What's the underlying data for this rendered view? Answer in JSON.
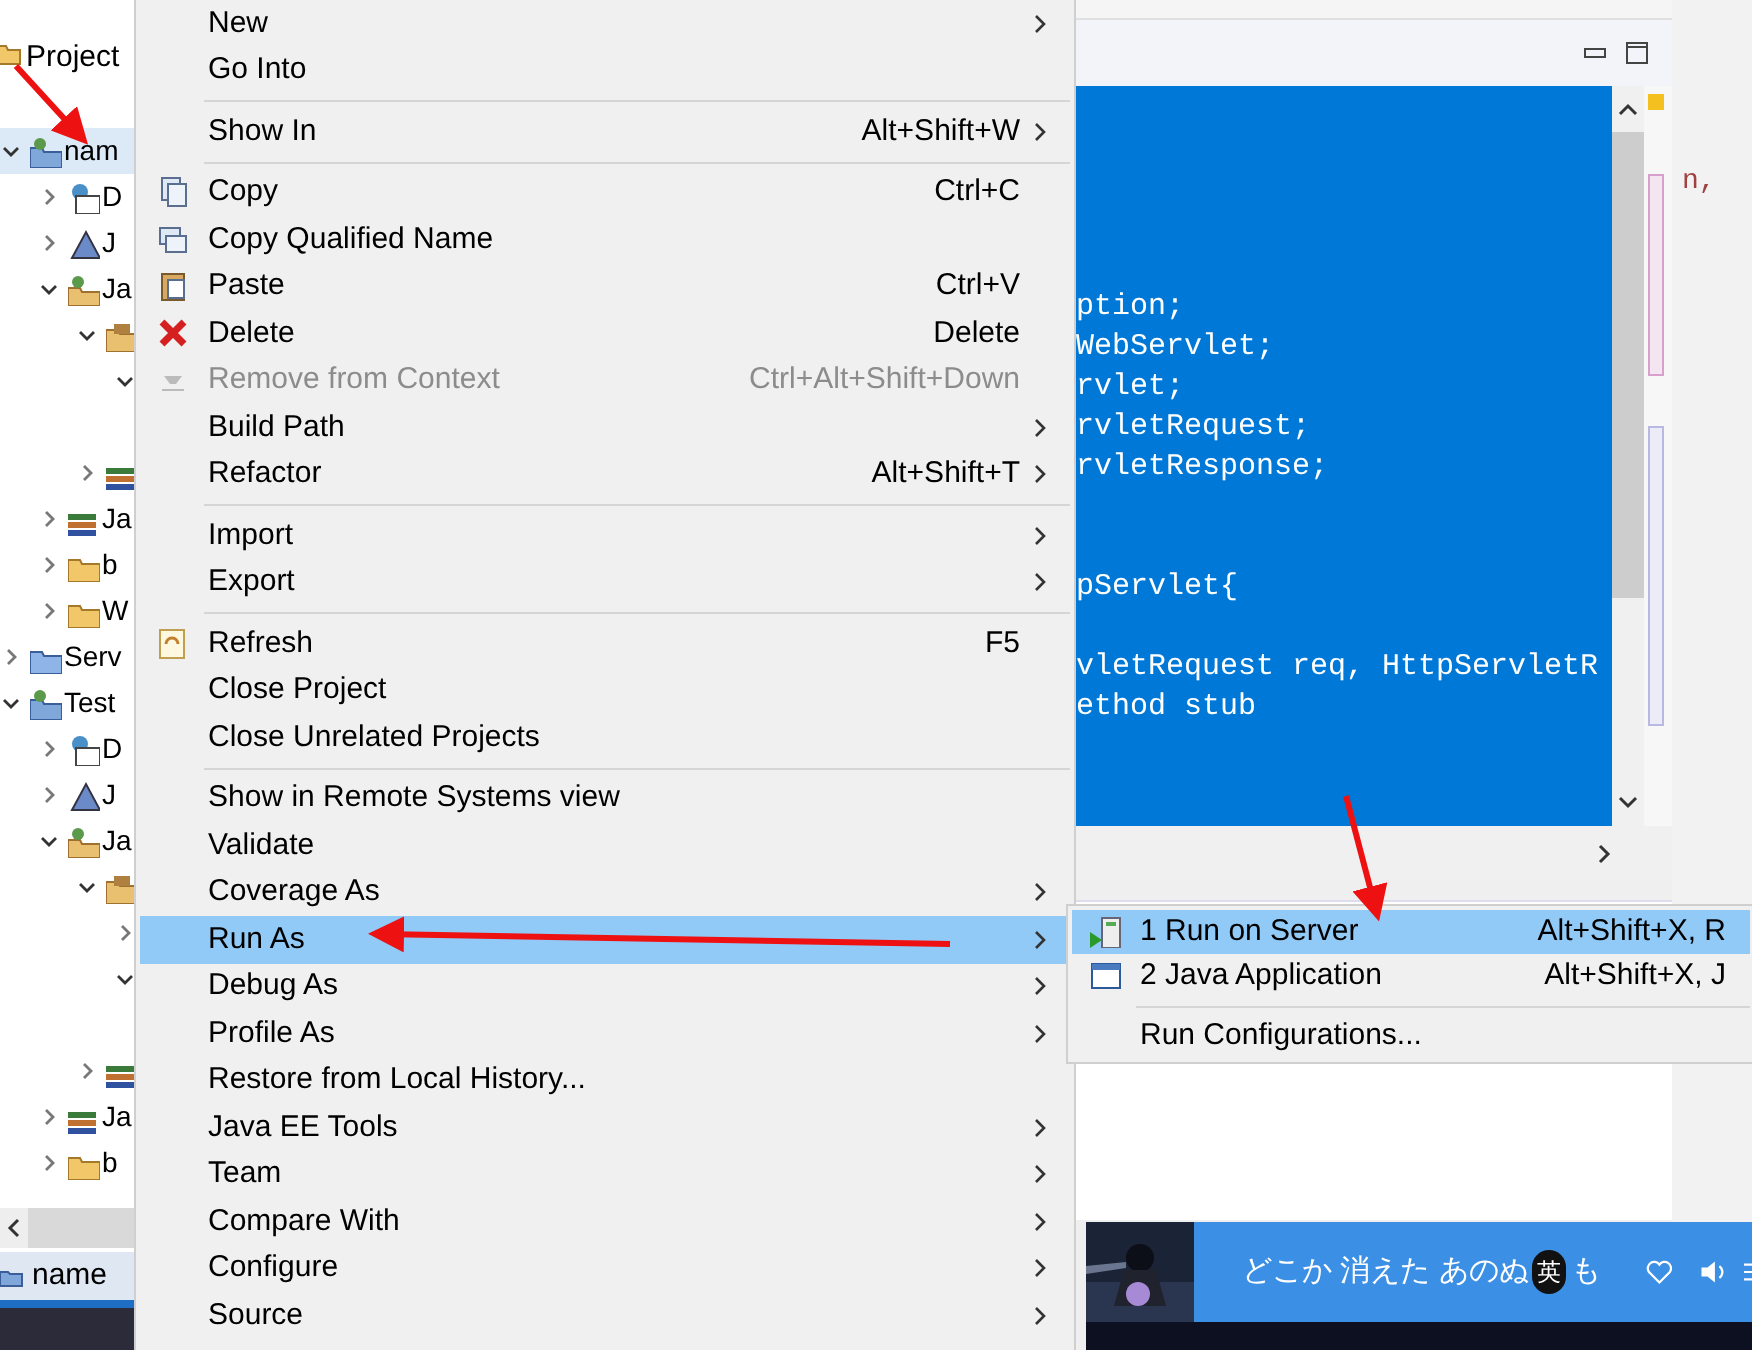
{
  "explorer": {
    "title": "Project",
    "tree": [
      {
        "label": "nam",
        "kind": "project",
        "expanded": true,
        "selected": true,
        "children": [
          {
            "label": "D",
            "kind": "descriptor",
            "expanded": false,
            "selected": false
          },
          {
            "label": "J",
            "kind": "webservices",
            "expanded": false,
            "selected": false
          },
          {
            "label": "Ja",
            "kind": "resources",
            "expanded": true,
            "selected": false,
            "children": [
              {
                "kind": "package",
                "expanded": true,
                "selected": false,
                "children": [
                  {
                    "kind": "none",
                    "expanded": true,
                    "selected": false
                  }
                ]
              },
              {
                "kind": "library",
                "expanded": false,
                "selected": false
              }
            ]
          },
          {
            "label": "Ja",
            "kind": "library",
            "expanded": false,
            "selected": false
          },
          {
            "label": "b",
            "kind": "folder",
            "expanded": false,
            "selected": false
          },
          {
            "label": "W",
            "kind": "folder",
            "expanded": false,
            "selected": false
          }
        ]
      },
      {
        "label": "Serv",
        "kind": "servers",
        "expanded": false,
        "selected": false
      },
      {
        "label": "Test",
        "kind": "project",
        "expanded": true,
        "selected": false,
        "children": [
          {
            "label": "D",
            "kind": "descriptor",
            "expanded": false,
            "selected": false
          },
          {
            "label": "J",
            "kind": "webservices",
            "expanded": false,
            "selected": false
          },
          {
            "label": "Ja",
            "kind": "resources",
            "expanded": true,
            "selected": false,
            "children": [
              {
                "kind": "package",
                "expanded": true,
                "selected": false,
                "children": [
                  {
                    "kind": "none",
                    "expanded": false,
                    "selected": false
                  },
                  {
                    "kind": "none",
                    "expanded": true,
                    "selected": false
                  }
                ]
              },
              {
                "kind": "library",
                "expanded": false,
                "selected": false
              }
            ]
          },
          {
            "label": "Ja",
            "kind": "library",
            "expanded": false,
            "selected": false
          },
          {
            "label": "b",
            "kind": "folder",
            "expanded": false,
            "selected": false
          }
        ]
      }
    ],
    "bottom_tab": "name"
  },
  "context_menu": [
    {
      "kind": "item",
      "label": "New",
      "submenu": true,
      "selected": false,
      "disabled": false
    },
    {
      "kind": "item",
      "label": "Go Into",
      "selected": false,
      "disabled": false
    },
    {
      "kind": "separator"
    },
    {
      "kind": "item",
      "label": "Show In",
      "shortcut": "Alt+Shift+W",
      "submenu": true,
      "selected": false,
      "disabled": false
    },
    {
      "kind": "separator"
    },
    {
      "kind": "item",
      "label": "Copy",
      "shortcut": "Ctrl+C",
      "selected": false,
      "disabled": false
    },
    {
      "kind": "item",
      "label": "Copy Qualified Name",
      "selected": false,
      "disabled": false
    },
    {
      "kind": "item",
      "label": "Paste",
      "shortcut": "Ctrl+V",
      "selected": false,
      "disabled": false
    },
    {
      "kind": "item",
      "label": "Delete",
      "shortcut": "Delete",
      "selected": false,
      "disabled": false
    },
    {
      "kind": "item",
      "label": "Remove from Context",
      "shortcut": "Ctrl+Alt+Shift+Down",
      "selected": false,
      "disabled": true
    },
    {
      "kind": "item",
      "label": "Build Path",
      "submenu": true,
      "selected": false,
      "disabled": false
    },
    {
      "kind": "item",
      "label": "Refactor",
      "shortcut": "Alt+Shift+T",
      "submenu": true,
      "selected": false,
      "disabled": false
    },
    {
      "kind": "separator"
    },
    {
      "kind": "item",
      "label": "Import",
      "submenu": true,
      "selected": false,
      "disabled": false
    },
    {
      "kind": "item",
      "label": "Export",
      "submenu": true,
      "selected": false,
      "disabled": false
    },
    {
      "kind": "separator"
    },
    {
      "kind": "item",
      "label": "Refresh",
      "shortcut": "F5",
      "selected": false,
      "disabled": false
    },
    {
      "kind": "item",
      "label": "Close Project",
      "selected": false,
      "disabled": false
    },
    {
      "kind": "item",
      "label": "Close Unrelated Projects",
      "selected": false,
      "disabled": false
    },
    {
      "kind": "separator"
    },
    {
      "kind": "item",
      "label": "Show in Remote Systems view",
      "selected": false,
      "disabled": false
    },
    {
      "kind": "item",
      "label": "Validate",
      "selected": false,
      "disabled": false
    },
    {
      "kind": "item",
      "label": "Coverage As",
      "submenu": true,
      "selected": false,
      "disabled": false
    },
    {
      "kind": "item",
      "label": "Run As",
      "submenu": true,
      "selected": true,
      "disabled": false
    },
    {
      "kind": "item",
      "label": "Debug As",
      "submenu": true,
      "selected": false,
      "disabled": false
    },
    {
      "kind": "item",
      "label": "Profile As",
      "submenu": true,
      "selected": false,
      "disabled": false
    },
    {
      "kind": "item",
      "label": "Restore from Local History...",
      "selected": false,
      "disabled": false
    },
    {
      "kind": "item",
      "label": "Java EE Tools",
      "submenu": true,
      "selected": false,
      "disabled": false
    },
    {
      "kind": "item",
      "label": "Team",
      "submenu": true,
      "selected": false,
      "disabled": false
    },
    {
      "kind": "item",
      "label": "Compare With",
      "submenu": true,
      "selected": false,
      "disabled": false
    },
    {
      "kind": "item",
      "label": "Configure",
      "submenu": true,
      "selected": false,
      "disabled": false
    },
    {
      "kind": "item",
      "label": "Source",
      "submenu": true,
      "selected": false,
      "disabled": false
    }
  ],
  "submenu": [
    {
      "kind": "item",
      "label": "1 Run on Server",
      "shortcut": "Alt+Shift+X, R",
      "selected": true
    },
    {
      "kind": "item",
      "label": "2 Java Application",
      "shortcut": "Alt+Shift+X, J",
      "selected": false
    },
    {
      "kind": "separator"
    },
    {
      "kind": "item",
      "label": "Run Configurations...",
      "selected": false
    }
  ],
  "editor": {
    "code_blocks": [
      [
        "ption;",
        "WebServlet;",
        "rvlet;",
        "rvletRequest;",
        "rvletResponse;"
      ],
      [
        "pServlet{"
      ],
      [
        "vletRequest req, HttpServletR",
        "ethod stub"
      ]
    ]
  },
  "background_code": "n,",
  "music_player": {
    "lyrics": "どこか 消えた あのぬ",
    "ime_badge": "英",
    "lyrics_after": "も",
    "liked": false
  }
}
